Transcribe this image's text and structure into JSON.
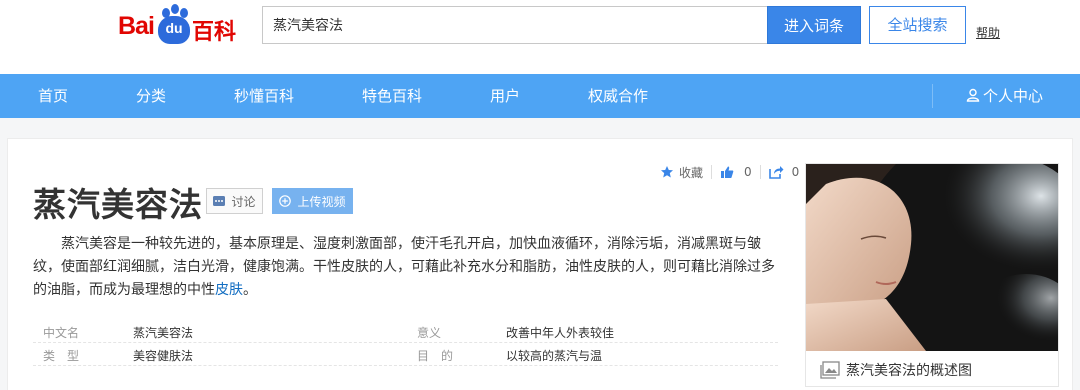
{
  "header": {
    "logo_text_1": "Bai",
    "logo_text_2": "du",
    "logo_text_3": "百科",
    "search_value": "蒸汽美容法",
    "enter_button": "进入词条",
    "all_search_button": "全站搜索",
    "help_link": "帮助"
  },
  "nav": {
    "items": [
      "首页",
      "分类",
      "秒懂百科",
      "特色百科",
      "用户",
      "权威合作"
    ],
    "user_center": "个人中心"
  },
  "actions": {
    "favorite_label": "收藏",
    "like_count": "0",
    "share_count": "0"
  },
  "entry": {
    "title": "蒸汽美容法",
    "discuss_button": "讨论",
    "upload_video_button": "上传视频",
    "summary_text": "蒸汽美容是一种较先进的，基本原理是、湿度刺激面部，使汗毛孔开启，加快血液循环，消除污垢，消减黑斑与皱纹，使面部红润细腻，洁白光滑，健康饱满。干性皮肤的人，可藉此补充水分和脂肪，油性皮肤的人，则可藉比消除过多的油脂，而成为最理想的中性",
    "summary_link": "皮肤",
    "summary_end": "。"
  },
  "info": [
    {
      "k1": "中文名",
      "v1": "蒸汽美容法",
      "k2": "意义",
      "v2": "改善中年人外表较佳"
    },
    {
      "k1": "类　型",
      "v1": "美容健肤法",
      "k2": "目　的",
      "v2": "以较高的蒸汽与温"
    }
  ],
  "image": {
    "caption": "蒸汽美容法的概述图"
  },
  "colors": {
    "nav_bg": "#4ea4f4",
    "primary_blue": "#3a86e8",
    "logo_red": "#e10602"
  }
}
